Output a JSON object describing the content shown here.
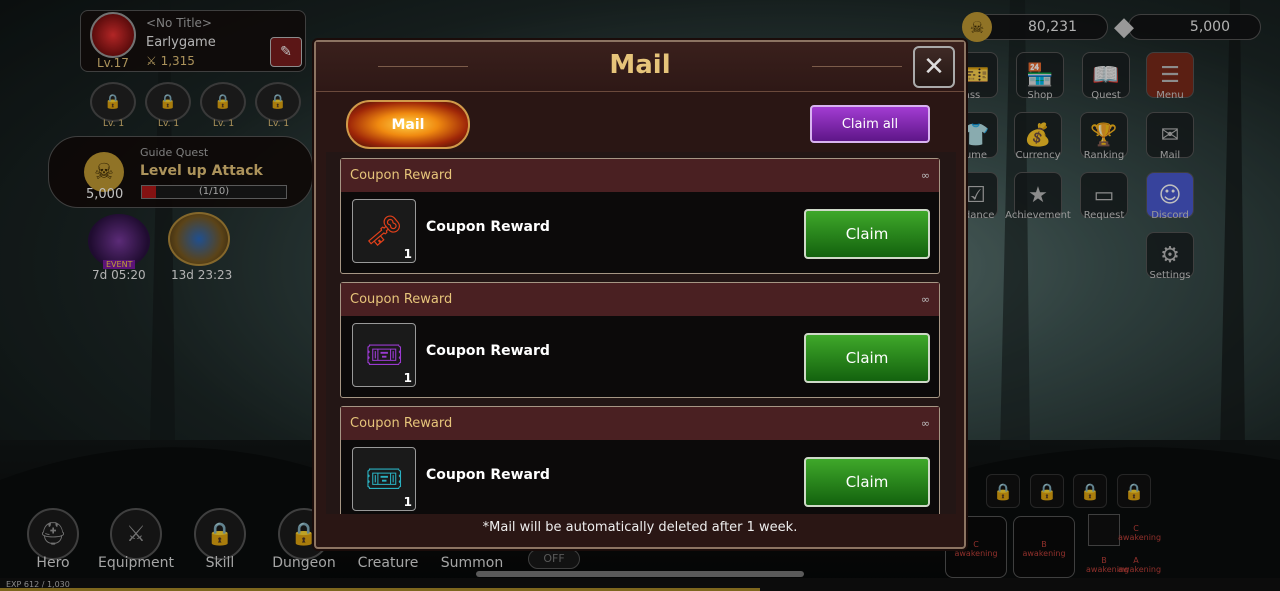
{
  "profile": {
    "title": "<No Title>",
    "name": "Earlygame",
    "level": "Lv.17",
    "power": "1,315"
  },
  "skill_slots": [
    "Lv. 1",
    "Lv. 1",
    "Lv. 1",
    "Lv. 1"
  ],
  "guide": {
    "label": "Guide Quest",
    "amount": "5,000",
    "quest": "Level up Attack",
    "progress": "(1/10)",
    "progress_fraction": 0.1
  },
  "events": [
    {
      "badge": "EVENT",
      "timer": "7d 05:20"
    },
    {
      "timer": "13d 23:23"
    }
  ],
  "currency": {
    "gold": "80,231",
    "gems": "5,000"
  },
  "right_menu": [
    "Shop",
    "Quest",
    "Menu",
    "Currency",
    "Ranking",
    "Mail",
    "Achievement",
    "Request",
    "Discord",
    "Settings"
  ],
  "partial_labels": {
    "pass": "ass",
    "costume": "tume",
    "attendance": "ndance"
  },
  "bottom_nav": [
    "Hero",
    "Equipment",
    "Skill",
    "Dungeon",
    "Creature",
    "Summon"
  ],
  "exp": "EXP 612 / 1,030",
  "exp_fraction": 0.594,
  "auto_toggle": "OFF",
  "awakening": [
    {
      "grade": "C",
      "label": "awakening"
    },
    {
      "grade": "B",
      "label": "awakening"
    },
    {
      "grade": "C",
      "label": "awakening"
    },
    {
      "grade": "B",
      "label": "awakening"
    },
    {
      "grade": "A",
      "label": "awakening"
    }
  ],
  "modal": {
    "title": "Mail",
    "tab": "Mail",
    "claim_all": "Claim all",
    "note": "*Mail will be automatically deleted after 1 week.",
    "mails": [
      {
        "header": "Coupon Reward",
        "duration": "∞",
        "title": "Coupon Reward",
        "qty": "1",
        "claim": "Claim",
        "icon": "flame-key-icon"
      },
      {
        "header": "Coupon Reward",
        "duration": "∞",
        "title": "Coupon Reward",
        "qty": "1",
        "claim": "Claim",
        "icon": "purple-ticket-icon"
      },
      {
        "header": "Coupon Reward",
        "duration": "∞",
        "title": "Coupon Reward",
        "qty": "1",
        "claim": "Claim",
        "icon": "teal-ticket-icon"
      }
    ]
  },
  "colors": {
    "gold_text": "#e6c47a",
    "claim_green": "#2a8a1e",
    "claim_all_purple": "#8a2ab8",
    "mail_header": "#4a2022"
  }
}
